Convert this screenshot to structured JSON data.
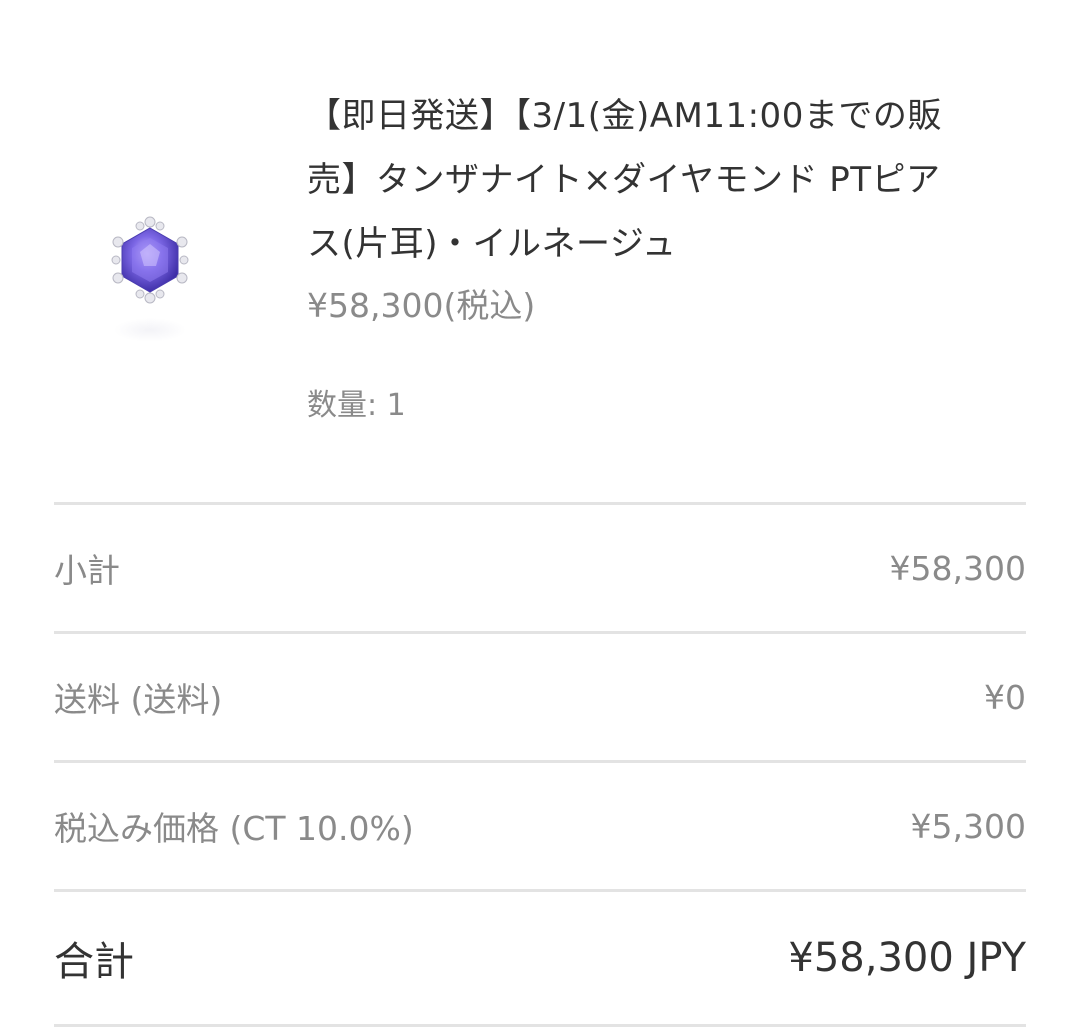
{
  "product": {
    "title": "【即日発送】【3/1(金)AM11:00までの販\n売】タンザナイト×ダイヤモンド PTピア\nス(片耳)・イルネージュ",
    "price": "¥58,300(税込)",
    "quantity": "数量: 1",
    "image_icon": "tanzanite-earring-image"
  },
  "summary": {
    "subtotal": {
      "label": "小計",
      "value": "¥58,300"
    },
    "shipping": {
      "label": "送料 (送料)",
      "value": "¥0"
    },
    "tax": {
      "label": "税込み価格 (CT 10.0%)",
      "value": "¥5,300"
    },
    "total": {
      "label": "合計",
      "value": "¥58,300 JPY"
    }
  },
  "colors": {
    "gem": "#6a5ad8",
    "divider": "#e3e3e3",
    "text_dark": "#333333",
    "text_muted": "#8a8a8a"
  }
}
